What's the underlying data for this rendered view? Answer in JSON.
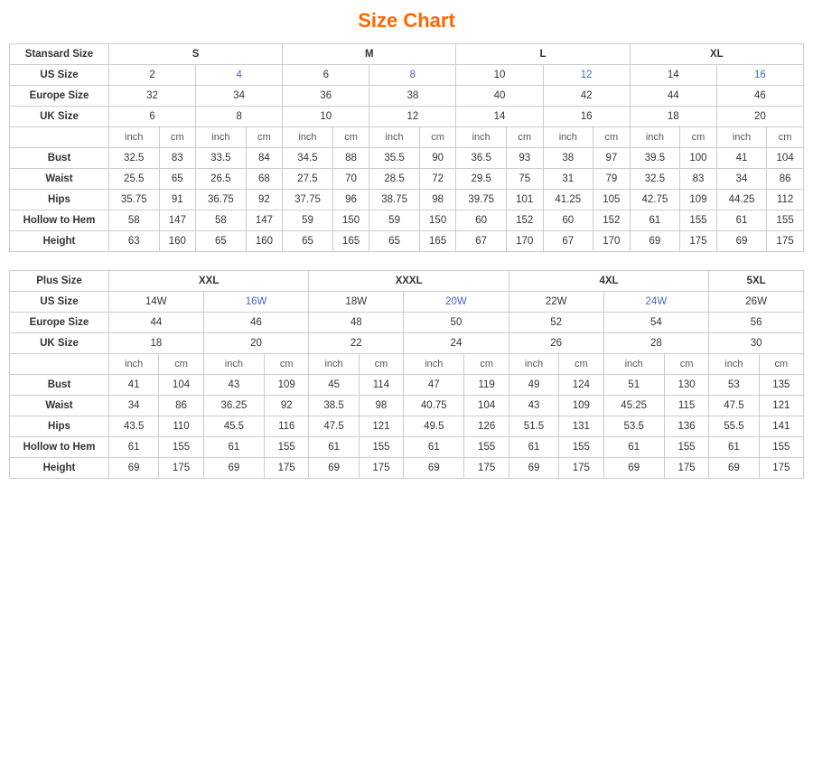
{
  "title": "Size Chart",
  "standard_table": {
    "headers": {
      "col1": "Stansard Size",
      "s": "S",
      "m": "M",
      "l": "L",
      "xl": "XL"
    },
    "us_size": {
      "label": "US Size",
      "values": [
        "2",
        "4",
        "6",
        "8",
        "10",
        "12",
        "14",
        "16"
      ]
    },
    "europe_size": {
      "label": "Europe Size",
      "values": [
        "32",
        "34",
        "36",
        "38",
        "40",
        "42",
        "44",
        "46"
      ]
    },
    "uk_size": {
      "label": "UK Size",
      "values": [
        "6",
        "8",
        "10",
        "12",
        "14",
        "16",
        "18",
        "20"
      ]
    },
    "units": [
      "inch",
      "cm",
      "inch",
      "cm",
      "inch",
      "cm",
      "inch",
      "cm",
      "inch",
      "cm",
      "inch",
      "cm",
      "inch",
      "cm",
      "inch",
      "cm"
    ],
    "bust": {
      "label": "Bust",
      "values": [
        "32.5",
        "83",
        "33.5",
        "84",
        "34.5",
        "88",
        "35.5",
        "90",
        "36.5",
        "93",
        "38",
        "97",
        "39.5",
        "100",
        "41",
        "104"
      ]
    },
    "waist": {
      "label": "Waist",
      "values": [
        "25.5",
        "65",
        "26.5",
        "68",
        "27.5",
        "70",
        "28.5",
        "72",
        "29.5",
        "75",
        "31",
        "79",
        "32.5",
        "83",
        "34",
        "86"
      ]
    },
    "hips": {
      "label": "Hips",
      "values": [
        "35.75",
        "91",
        "36.75",
        "92",
        "37.75",
        "96",
        "38.75",
        "98",
        "39.75",
        "101",
        "41.25",
        "105",
        "42.75",
        "109",
        "44.25",
        "112"
      ]
    },
    "hollow": {
      "label": "Hollow to Hem",
      "values": [
        "58",
        "147",
        "58",
        "147",
        "59",
        "150",
        "59",
        "150",
        "60",
        "152",
        "60",
        "152",
        "61",
        "155",
        "61",
        "155"
      ]
    },
    "height": {
      "label": "Height",
      "values": [
        "63",
        "160",
        "65",
        "160",
        "65",
        "165",
        "65",
        "165",
        "67",
        "170",
        "67",
        "170",
        "69",
        "175",
        "69",
        "175"
      ]
    }
  },
  "plus_table": {
    "headers": {
      "col1": "Plus Size",
      "xxl": "XXL",
      "xxxl": "XXXL",
      "4xl": "4XL",
      "5xl": "5XL"
    },
    "us_size": {
      "label": "US Size",
      "values": [
        "14W",
        "16W",
        "18W",
        "20W",
        "22W",
        "24W",
        "26W"
      ]
    },
    "europe_size": {
      "label": "Europe Size",
      "values": [
        "44",
        "46",
        "48",
        "50",
        "52",
        "54",
        "56"
      ]
    },
    "uk_size": {
      "label": "UK Size",
      "values": [
        "18",
        "20",
        "22",
        "24",
        "26",
        "28",
        "30"
      ]
    },
    "units": [
      "inch",
      "cm",
      "inch",
      "cm",
      "inch",
      "cm",
      "inch",
      "cm",
      "inch",
      "cm",
      "inch",
      "cm",
      "inch",
      "cm"
    ],
    "bust": {
      "label": "Bust",
      "values": [
        "41",
        "104",
        "43",
        "109",
        "45",
        "114",
        "47",
        "119",
        "49",
        "124",
        "51",
        "130",
        "53",
        "135"
      ]
    },
    "waist": {
      "label": "Waist",
      "values": [
        "34",
        "86",
        "36.25",
        "92",
        "38.5",
        "98",
        "40.75",
        "104",
        "43",
        "109",
        "45.25",
        "115",
        "47.5",
        "121"
      ]
    },
    "hips": {
      "label": "Hips",
      "values": [
        "43.5",
        "110",
        "45.5",
        "116",
        "47.5",
        "121",
        "49.5",
        "126",
        "51.5",
        "131",
        "53.5",
        "136",
        "55.5",
        "141"
      ]
    },
    "hollow": {
      "label": "Hollow to Hem",
      "values": [
        "61",
        "155",
        "61",
        "155",
        "61",
        "155",
        "61",
        "155",
        "61",
        "155",
        "61",
        "155",
        "61",
        "155"
      ]
    },
    "height": {
      "label": "Height",
      "values": [
        "69",
        "175",
        "69",
        "175",
        "69",
        "175",
        "69",
        "175",
        "69",
        "175",
        "69",
        "175",
        "69",
        "175"
      ]
    }
  }
}
